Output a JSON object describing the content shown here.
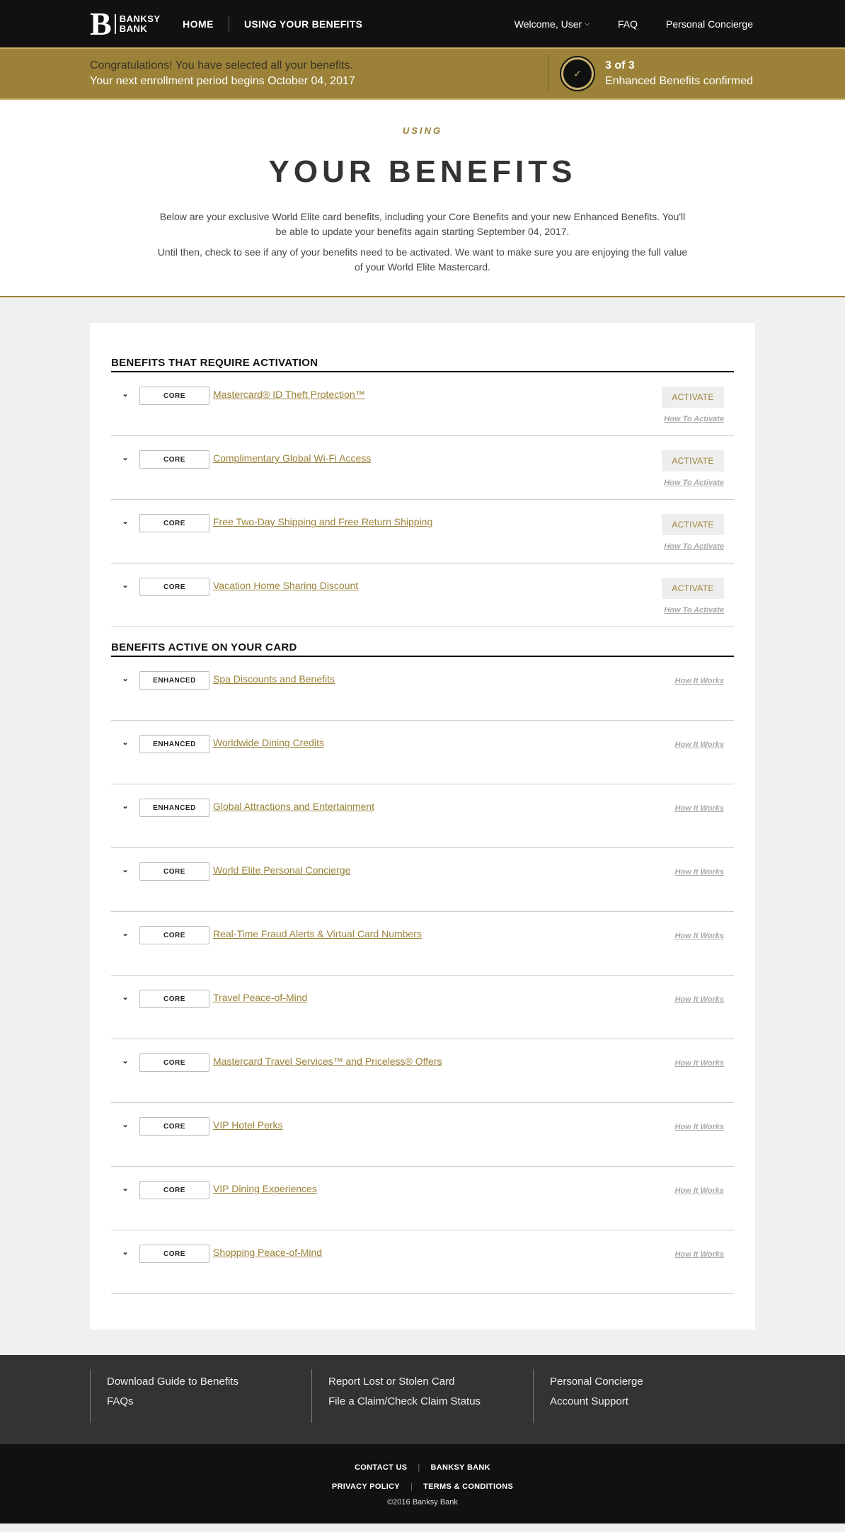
{
  "nav": {
    "logo_mark": "B",
    "logo_line1": "BANKSY",
    "logo_line2": "BANK",
    "home": "HOME",
    "using": "USING YOUR BENEFITS",
    "welcome": "Welcome, User",
    "faq": "FAQ",
    "concierge": "Personal Concierge"
  },
  "banner": {
    "line1": "Congratulations! You have selected all your benefits.",
    "line2": "Your next enrollment period begins October 04, 2017",
    "count": "3 of 3",
    "count_label": "Enhanced Benefits confirmed"
  },
  "hero": {
    "eyebrow": "USING",
    "title": "YOUR BENEFITS",
    "p1": "Below are your exclusive World Elite card benefits, including your Core Benefits and your new Enhanced Benefits. You'll be able to update your benefits again starting September 04, 2017.",
    "p2": "Until then, check to see if any of your benefits need to be activated. We want to make sure you are enjoying the full value of your World Elite Mastercard."
  },
  "sections": {
    "activation_title": "BENEFITS THAT REQUIRE ACTIVATION",
    "active_title": "BENEFITS ACTIVE ON YOUR CARD",
    "activate_label": "ACTIVATE",
    "how_to_activate": "How To Activate",
    "how_it_works": "How It Works"
  },
  "activation_benefits": [
    {
      "tag": "CORE",
      "name": "Mastercard® ID Theft Protection™"
    },
    {
      "tag": "CORE",
      "name": "Complimentary Global Wi-Fi Access"
    },
    {
      "tag": "CORE",
      "name": "Free Two-Day Shipping and Free Return Shipping"
    },
    {
      "tag": "CORE",
      "name": "Vacation Home Sharing Discount"
    }
  ],
  "active_benefits": [
    {
      "tag": "ENHANCED",
      "name": "Spa Discounts and Benefits"
    },
    {
      "tag": "ENHANCED",
      "name": "Worldwide Dining Credits"
    },
    {
      "tag": "ENHANCED",
      "name": "Global Attractions and Entertainment"
    },
    {
      "tag": "CORE",
      "name": "World Elite Personal Concierge"
    },
    {
      "tag": "CORE",
      "name": "Real-Time Fraud Alerts & Virtual Card Numbers"
    },
    {
      "tag": "CORE",
      "name": "Travel Peace-of-Mind"
    },
    {
      "tag": "CORE",
      "name": "Mastercard Travel Services™ and Priceless® Offers"
    },
    {
      "tag": "CORE",
      "name": "VIP Hotel Perks"
    },
    {
      "tag": "CORE",
      "name": "VIP Dining Experiences"
    },
    {
      "tag": "CORE",
      "name": "Shopping Peace-of-Mind"
    }
  ],
  "footer": {
    "col1": [
      "Download Guide to Benefits",
      "FAQs"
    ],
    "col2": [
      "Report Lost or Stolen Card",
      "File a Claim/Check Claim Status"
    ],
    "col3": [
      "Personal Concierge",
      "Account Support"
    ],
    "contact": "CONTACT US",
    "bank": "BANKSY BANK",
    "privacy": "PRIVACY POLICY",
    "terms": "TERMS & CONDITIONS",
    "copyright": "©2016 Banksy Bank"
  },
  "colors": {
    "gold": "#9b8238",
    "dark": "#111111"
  }
}
